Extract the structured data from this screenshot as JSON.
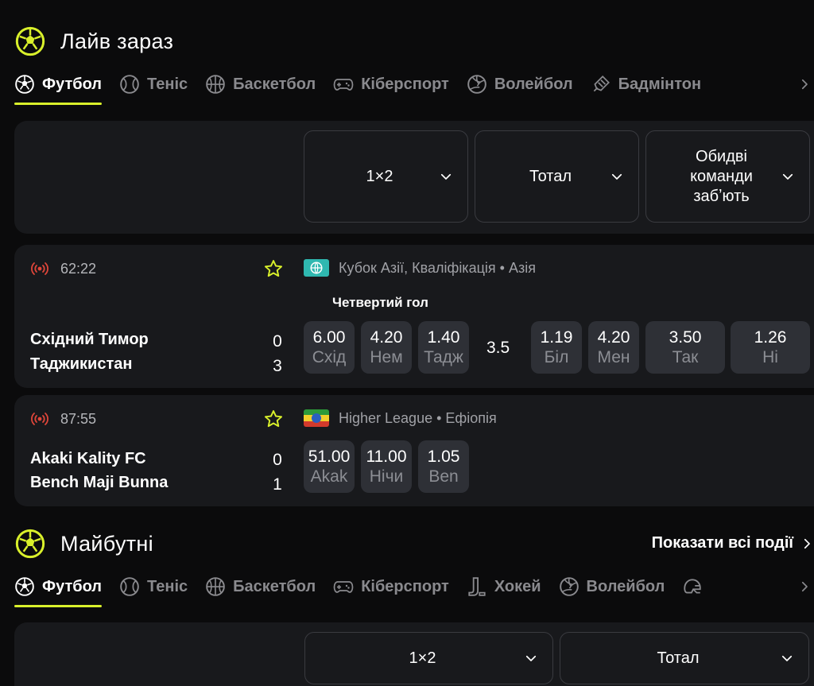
{
  "colors": {
    "accent": "#d9f02b",
    "live_red": "#e0463a",
    "panel": "#18191c",
    "odd_bg": "#2e3036"
  },
  "live_section": {
    "title": "Лайв зараз",
    "tabs": [
      {
        "label": "Футбол",
        "icon": "soccer-icon",
        "active": true
      },
      {
        "label": "Теніс",
        "icon": "tennis-icon"
      },
      {
        "label": "Баскетбол",
        "icon": "basketball-icon"
      },
      {
        "label": "Кіберспорт",
        "icon": "gamepad-icon"
      },
      {
        "label": "Волейбол",
        "icon": "volleyball-icon"
      },
      {
        "label": "Бадмінтон",
        "icon": "shuttlecock-icon"
      }
    ],
    "markets": {
      "m1": "1×2",
      "m2": "Тотал",
      "m3_l1": "Обидві",
      "m3_l2": "команди",
      "m3_l3": "забʼють"
    },
    "matches": [
      {
        "time": "62:22",
        "league": "Кубок Азії, Кваліфікація • Азія",
        "flag": "globe",
        "market_title": "Четвертий гол",
        "team1": "Східний Тимор",
        "score1": "0",
        "team2": "Таджикистан",
        "score2": "3",
        "odds": [
          {
            "val": "6.00",
            "sub": "Схід"
          },
          {
            "val": "4.20",
            "sub": "Нем"
          },
          {
            "val": "1.40",
            "sub": "Тадж"
          }
        ],
        "handicap": "3.5",
        "total": [
          {
            "val": "1.19",
            "sub": "Біл"
          },
          {
            "val": "4.20",
            "sub": "Мен"
          }
        ],
        "btts": [
          {
            "val": "3.50",
            "sub": "Так"
          },
          {
            "val": "1.26",
            "sub": "Ні"
          }
        ]
      },
      {
        "time": "87:55",
        "league": "Higher League • Ефіопія",
        "flag": "ethiopia",
        "team1": "Akaki Kality FC",
        "score1": "0",
        "team2": "Bench Maji Bunna",
        "score2": "1",
        "odds": [
          {
            "val": "51.00",
            "sub": "Akak"
          },
          {
            "val": "11.00",
            "sub": "Нічи"
          },
          {
            "val": "1.05",
            "sub": "Ben"
          }
        ]
      }
    ]
  },
  "upcoming_section": {
    "title": "Майбутні",
    "show_all": "Показати всі події",
    "tabs": [
      {
        "label": "Футбол",
        "icon": "soccer-icon",
        "active": true
      },
      {
        "label": "Теніс",
        "icon": "tennis-icon"
      },
      {
        "label": "Баскетбол",
        "icon": "basketball-icon"
      },
      {
        "label": "Кіберспорт",
        "icon": "gamepad-icon"
      },
      {
        "label": "Хокей",
        "icon": "hockey-stick-icon"
      },
      {
        "label": "Волейбол",
        "icon": "volleyball-icon"
      },
      {
        "label": "",
        "icon": "helmet-icon"
      }
    ],
    "markets": {
      "m1": "1×2",
      "m2": "Тотал"
    }
  }
}
